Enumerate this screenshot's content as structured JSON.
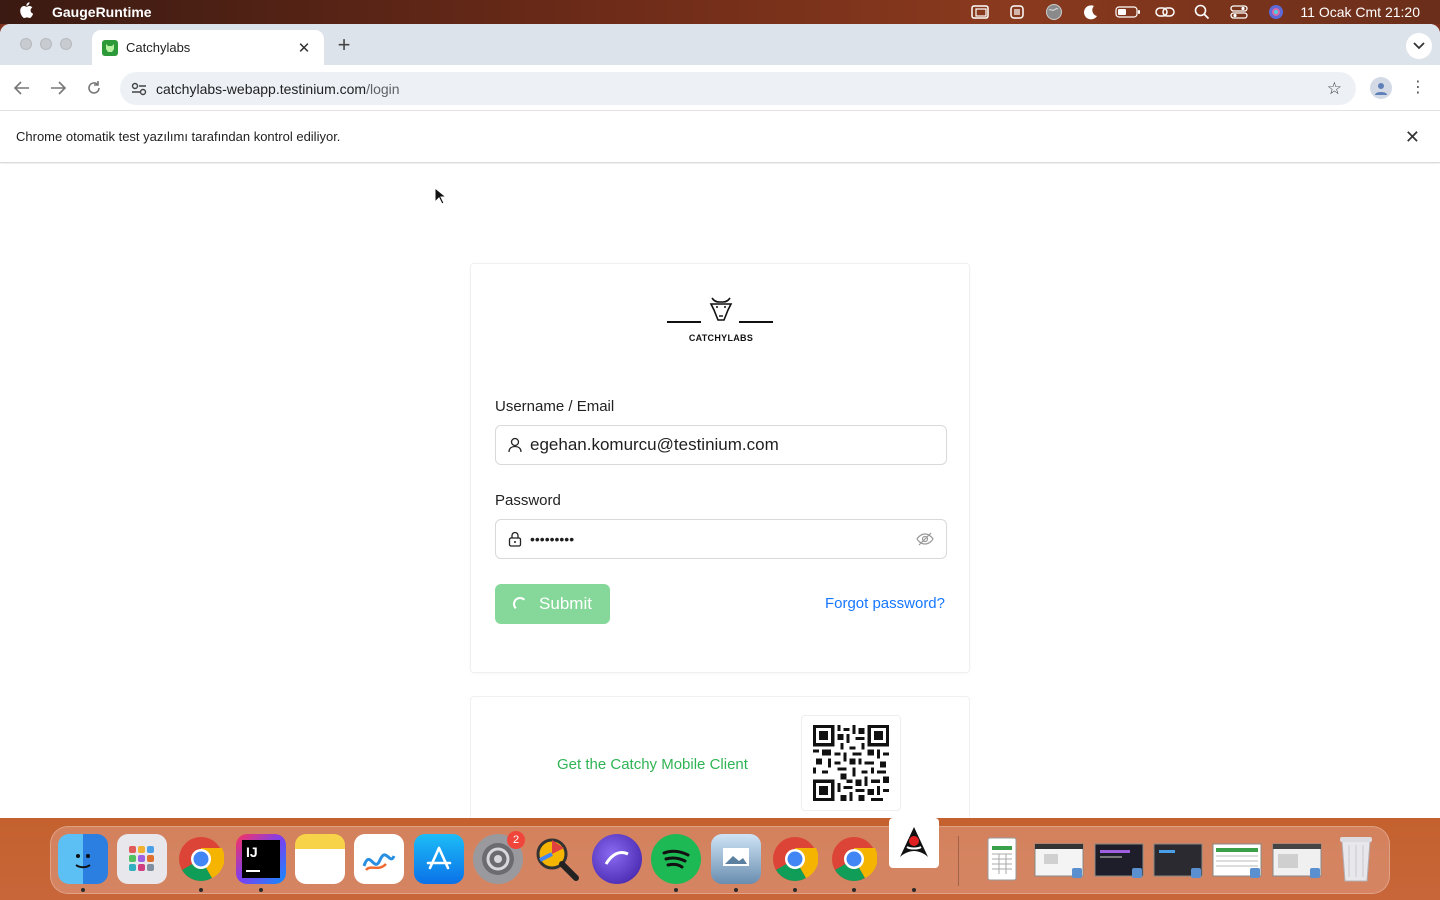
{
  "menubar": {
    "app_name": "GaugeRuntime",
    "clock": "11 Ocak Cmt  21:20"
  },
  "browser": {
    "tab_title": "Catchylabs",
    "url_host": "catchylabs-webapp.testinium.com",
    "url_path": "/login",
    "infobar_text": "Chrome otomatik test yazılımı tarafından kontrol ediliyor."
  },
  "login": {
    "brand": "CATCHYLABS",
    "username_label": "Username / Email",
    "username_value": "egehan.komurcu@testinium.com",
    "password_label": "Password",
    "password_value": "•••••••••",
    "submit_label": "Submit",
    "submit_state": "loading",
    "forgot_label": "Forgot password?"
  },
  "mobile": {
    "link_label": "Get the Catchy Mobile Client"
  },
  "dock": {
    "settings_badge": "2"
  },
  "colors": {
    "submit_bg": "#86d89a",
    "link_blue": "#1677ff",
    "mobile_green": "#2fb455"
  }
}
